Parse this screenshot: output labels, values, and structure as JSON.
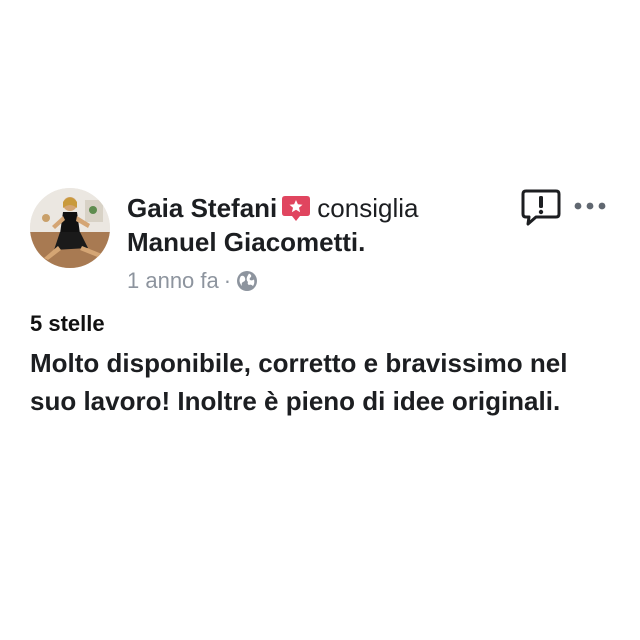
{
  "post": {
    "author_name": "Gaia Stefani",
    "recommend_verb": "consiglia",
    "recommended_page": "Manuel Giacometti.",
    "timestamp": "1 anno fa",
    "separator": "·",
    "privacy_icon": "globe-icon",
    "rating_label": "5 stelle",
    "review_text": "Molto disponibile, corretto e bravissimo nel suo lavoro! Inoltre è pieno di idee originali."
  },
  "icons": {
    "recommend_badge": "recommend-star-icon",
    "report": "report-exclamation-icon",
    "more": "more-options-icon"
  },
  "colors": {
    "recommend_badge": "#e0455f",
    "meta_text": "#8d949e",
    "primary_text": "#1c1e21"
  }
}
